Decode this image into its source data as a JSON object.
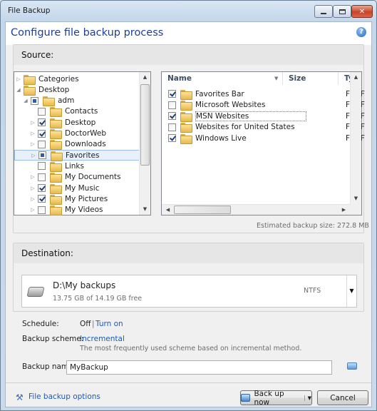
{
  "window": {
    "title": "File Backup"
  },
  "header": {
    "title": "Configure file backup process",
    "help_icon": "?"
  },
  "source": {
    "label": "Source:",
    "tree": [
      {
        "label": "Categories",
        "depth": 0,
        "check": "none",
        "icon": "categories-icon"
      },
      {
        "label": "Desktop",
        "depth": 0,
        "check": "none",
        "icon": "desktop-icon"
      },
      {
        "label": "adm",
        "depth": 1,
        "check": "partial",
        "icon": "user-folder-icon"
      },
      {
        "label": "Contacts",
        "depth": 2,
        "check": "off",
        "icon": "folder-icon"
      },
      {
        "label": "Desktop",
        "depth": 2,
        "check": "on",
        "icon": "folder-icon"
      },
      {
        "label": "DoctorWeb",
        "depth": 2,
        "check": "on",
        "icon": "folder-icon"
      },
      {
        "label": "Downloads",
        "depth": 2,
        "check": "off",
        "icon": "folder-icon"
      },
      {
        "label": "Favorites",
        "depth": 2,
        "check": "partial",
        "icon": "folder-icon",
        "selected": true
      },
      {
        "label": "Links",
        "depth": 2,
        "check": "off",
        "icon": "folder-icon"
      },
      {
        "label": "My Documents",
        "depth": 2,
        "check": "off",
        "icon": "folder-icon"
      },
      {
        "label": "My Music",
        "depth": 2,
        "check": "on",
        "icon": "folder-icon"
      },
      {
        "label": "My Pictures",
        "depth": 2,
        "check": "on",
        "icon": "folder-icon"
      },
      {
        "label": "My Videos",
        "depth": 2,
        "check": "off",
        "icon": "folder-icon"
      }
    ],
    "columns": {
      "name": "Name",
      "size": "Size",
      "type": "Typ"
    },
    "files": [
      {
        "name": "Favorites Bar",
        "check": "on",
        "type": "File F"
      },
      {
        "name": "Microsoft Websites",
        "check": "off",
        "type": "File F"
      },
      {
        "name": "MSN Websites",
        "check": "on",
        "type": "File F",
        "focused": true
      },
      {
        "name": "Websites for United States",
        "check": "off",
        "type": "File F"
      },
      {
        "name": "Windows Live",
        "check": "on",
        "type": "File F"
      }
    ],
    "estimated": "Estimated backup size: 272.8 MB"
  },
  "destination": {
    "label": "Destination:",
    "path": "D:\\My backups",
    "space": "13.75 GB of 14.19 GB free",
    "fs": "NTFS"
  },
  "schedule": {
    "label": "Schedule:",
    "value": "Off",
    "sep": "|",
    "link": "Turn on"
  },
  "scheme": {
    "label": "Backup scheme:",
    "link": "Incremental",
    "desc": "The most frequently used scheme based on incremental method."
  },
  "backup_name": {
    "label": "Backup name:",
    "value": "MyBackup"
  },
  "footer": {
    "options_link": "File backup options",
    "backup_button": "Back up now",
    "cancel_button": "Cancel"
  }
}
